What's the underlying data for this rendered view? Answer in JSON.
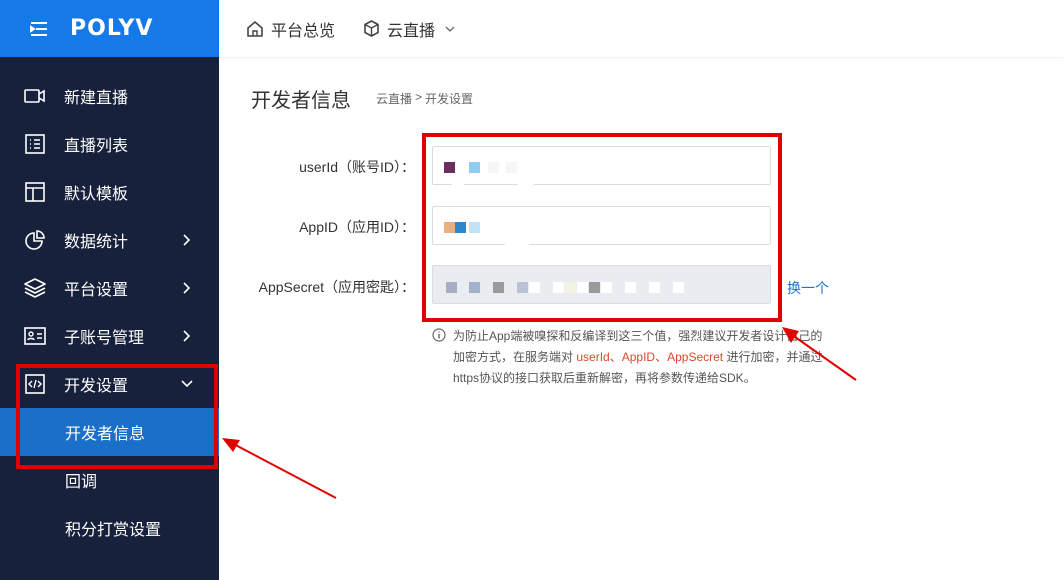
{
  "brand": {
    "logo_text": "POLYV",
    "color": "#1579e8"
  },
  "sidebar": {
    "items": [
      {
        "label": "新建直播",
        "icon": "video-camera-icon",
        "has_chevron": false
      },
      {
        "label": "直播列表",
        "icon": "list-icon",
        "has_chevron": false
      },
      {
        "label": "默认模板",
        "icon": "template-icon",
        "has_chevron": false
      },
      {
        "label": "数据统计",
        "icon": "pie-chart-icon",
        "has_chevron": true
      },
      {
        "label": "平台设置",
        "icon": "layers-icon",
        "has_chevron": true
      },
      {
        "label": "子账号管理",
        "icon": "id-card-icon",
        "has_chevron": true
      },
      {
        "label": "开发设置",
        "icon": "code-icon",
        "has_chevron": true,
        "expanded": true
      }
    ],
    "sub_items": [
      {
        "label": "开发者信息",
        "active": true
      },
      {
        "label": "回调",
        "active": false
      },
      {
        "label": "积分打赏设置",
        "active": false
      }
    ]
  },
  "topbar": {
    "overview_label": "平台总览",
    "cloud_live_label": "云直播"
  },
  "page": {
    "title": "开发者信息",
    "breadcrumb": [
      "云直播",
      ">",
      "开发设置"
    ]
  },
  "form": {
    "userid_label": "userId（账号ID）：",
    "appid_label": "AppID（应用ID）：",
    "appsecret_label": "AppSecret（应用密匙）：",
    "swap_label": "换一个"
  },
  "notice": {
    "line1": "为防止App端被嗅探和反编译到这三个值，强烈建议开发者设计自己的",
    "line2_a": "加密方式，在服务端对 ",
    "userid": "userId",
    "sep1": "、",
    "appid": "AppID",
    "sep2": "、",
    "appsecret": "AppSecret",
    "line2_b": " 进行加密，并通过",
    "line3": "https协议的接口获取后重新解密，再将参数传递给SDK。"
  },
  "colors": {
    "sidebar_bg": "#17213b",
    "active_item": "#1a6fc8",
    "highlight": "#e1462c",
    "link": "#1a73d1",
    "annotation_red": "#e10000"
  }
}
